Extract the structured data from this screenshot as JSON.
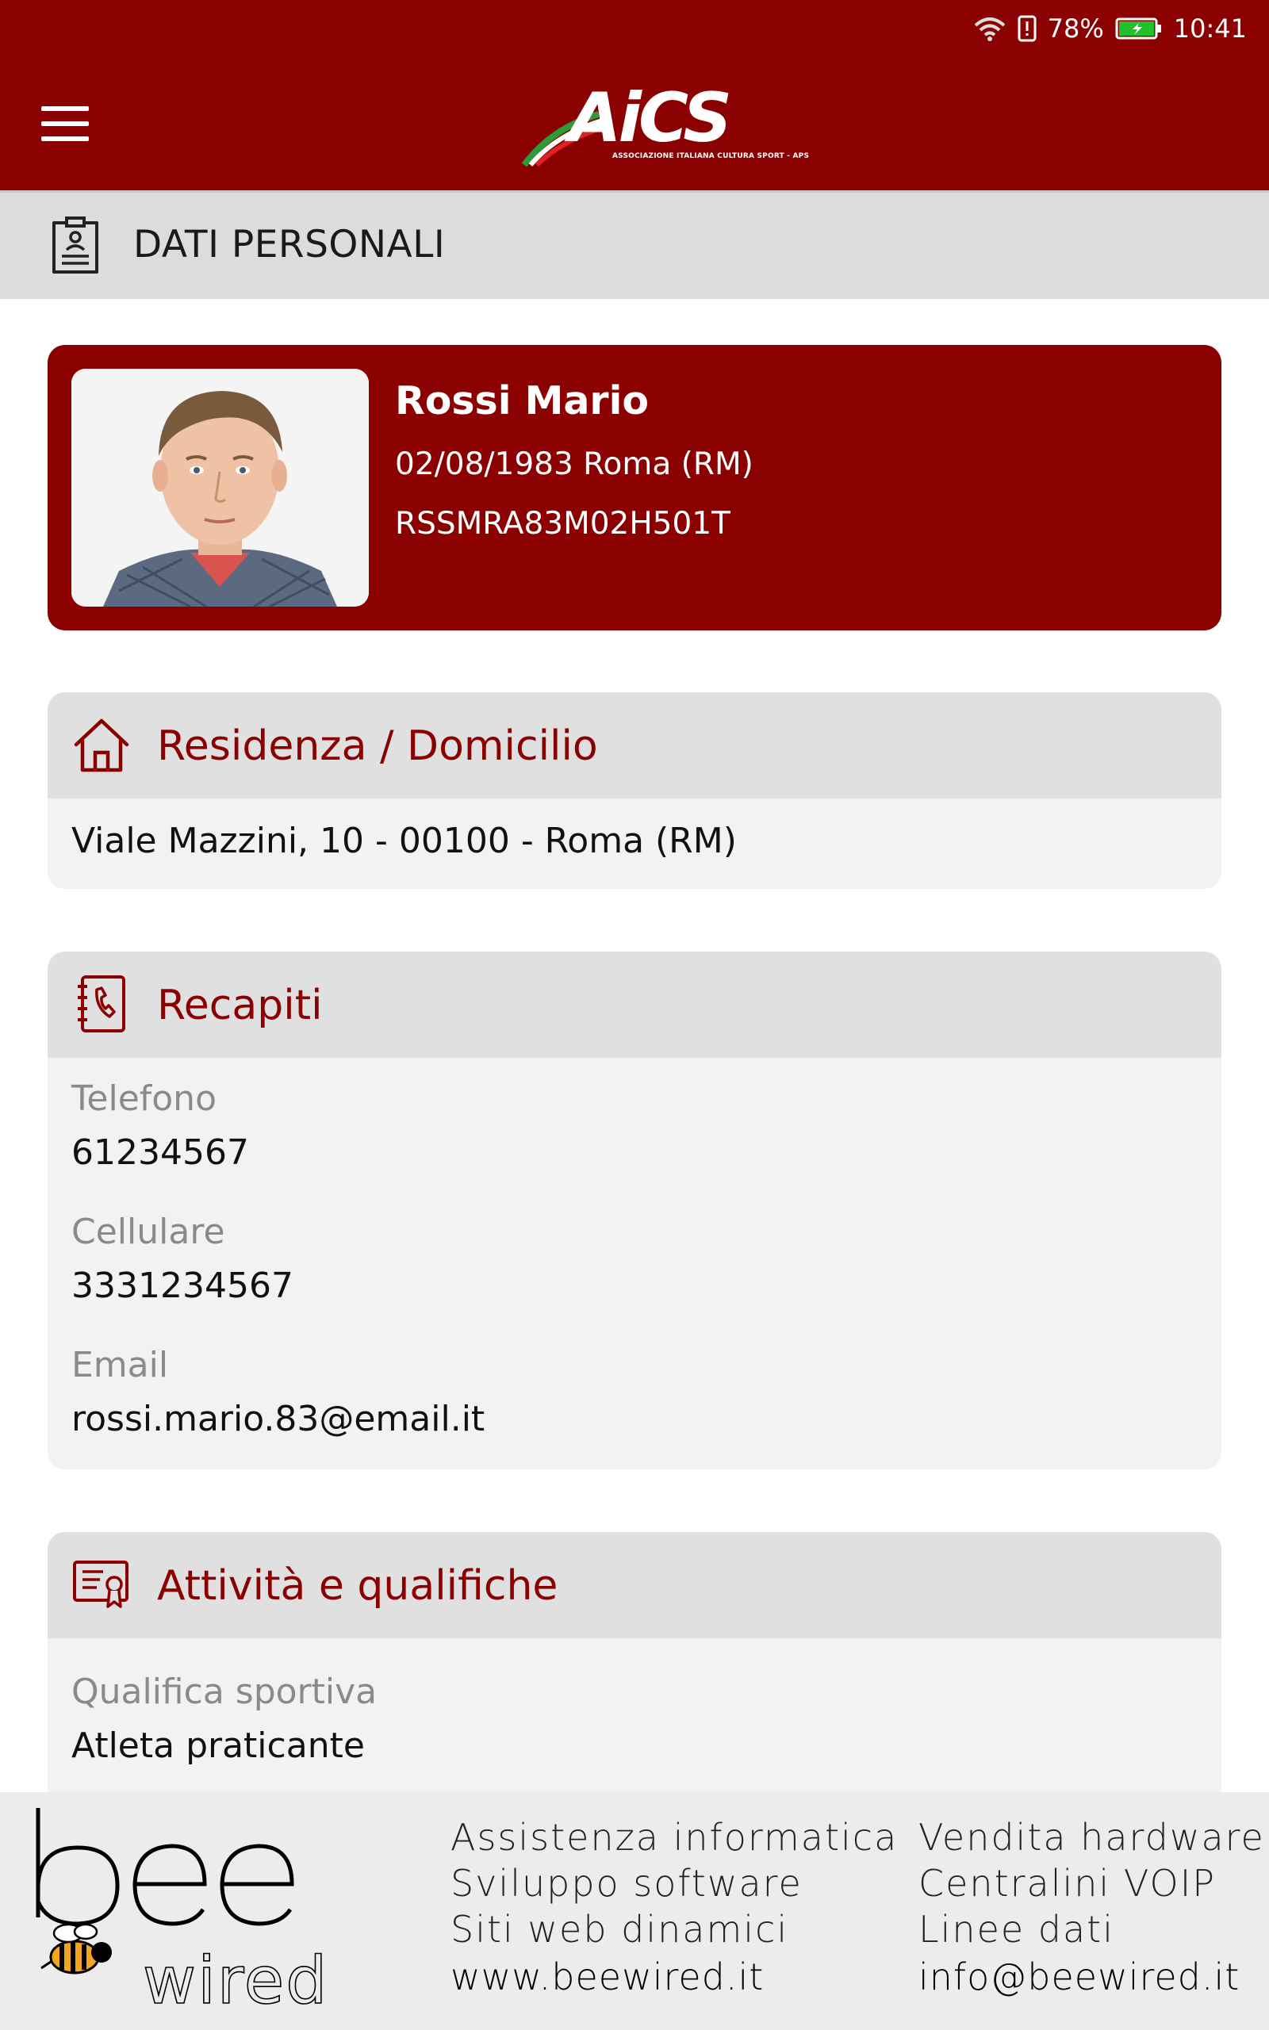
{
  "status_bar": {
    "battery": "78%",
    "time": "10:41"
  },
  "header": {
    "logo_text": "AiCS",
    "logo_subtitle": "ASSOCIAZIONE ITALIANA CULTURA SPORT - APS"
  },
  "section": {
    "title": "DATI PERSONALI"
  },
  "profile": {
    "name": "Rossi Mario",
    "birth": "02/08/1983 Roma (RM)",
    "fiscal_code": "RSSMRA83M02H501T"
  },
  "residence": {
    "title": "Residenza / Domicilio",
    "address": "Viale Mazzini, 10 - 00100 - Roma (RM)"
  },
  "contacts": {
    "title": "Recapiti",
    "phone_label": "Telefono",
    "phone": "61234567",
    "mobile_label": "Cellulare",
    "mobile": "3331234567",
    "email_label": "Email",
    "email": "rossi.mario.83@email.it"
  },
  "activities": {
    "title": "Attività e qualifiche",
    "qualification_label": "Qualifica sportiva",
    "qualification": "Atleta praticante"
  },
  "footer": {
    "brand_top": "bee",
    "brand_bottom": "wired",
    "col1": [
      "Assistenza informatica",
      "Sviluppo software",
      "Siti web dinamici",
      "www.beewired.it"
    ],
    "col2": [
      "Vendita hardware",
      "Centralini VOIP",
      "Linee dati",
      "info@beewired.it"
    ]
  },
  "colors": {
    "brand": "#8b0000",
    "section_bar": "#dcdcdc",
    "card_bg": "#f2f2f2"
  }
}
